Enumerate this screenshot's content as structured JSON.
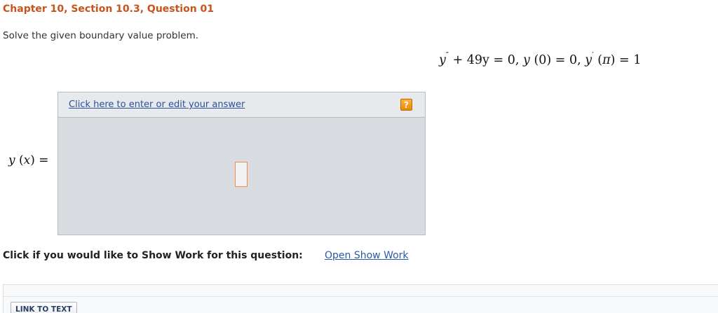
{
  "question": {
    "title": "Chapter 10, Section 10.3, Question 01",
    "prompt": "Solve the given boundary value problem."
  },
  "equation": {
    "y1": "y",
    "dd": "″",
    "part1": " + 49y = 0,  ",
    "y2": "y",
    "part2": " (0) = 0,  ",
    "y3": "y",
    "d": "′",
    "part3": " (",
    "pi": "π",
    "part4": ") = 1"
  },
  "answer": {
    "label_y": "y",
    "label_rest": " (",
    "label_x": "x",
    "label_end": ") =",
    "edit_link": "Click here to enter or edit your answer",
    "help_icon": "?"
  },
  "show_work": {
    "prompt": "Click if you would like to Show Work for this question:",
    "link": "Open Show Work"
  },
  "footer": {
    "link_to_text": "LINK TO TEXT"
  },
  "colors": {
    "title": "#c8541c",
    "link": "#2a5aa8",
    "placeholder_border": "#f08a4b",
    "help_icon": "#f39a16"
  }
}
